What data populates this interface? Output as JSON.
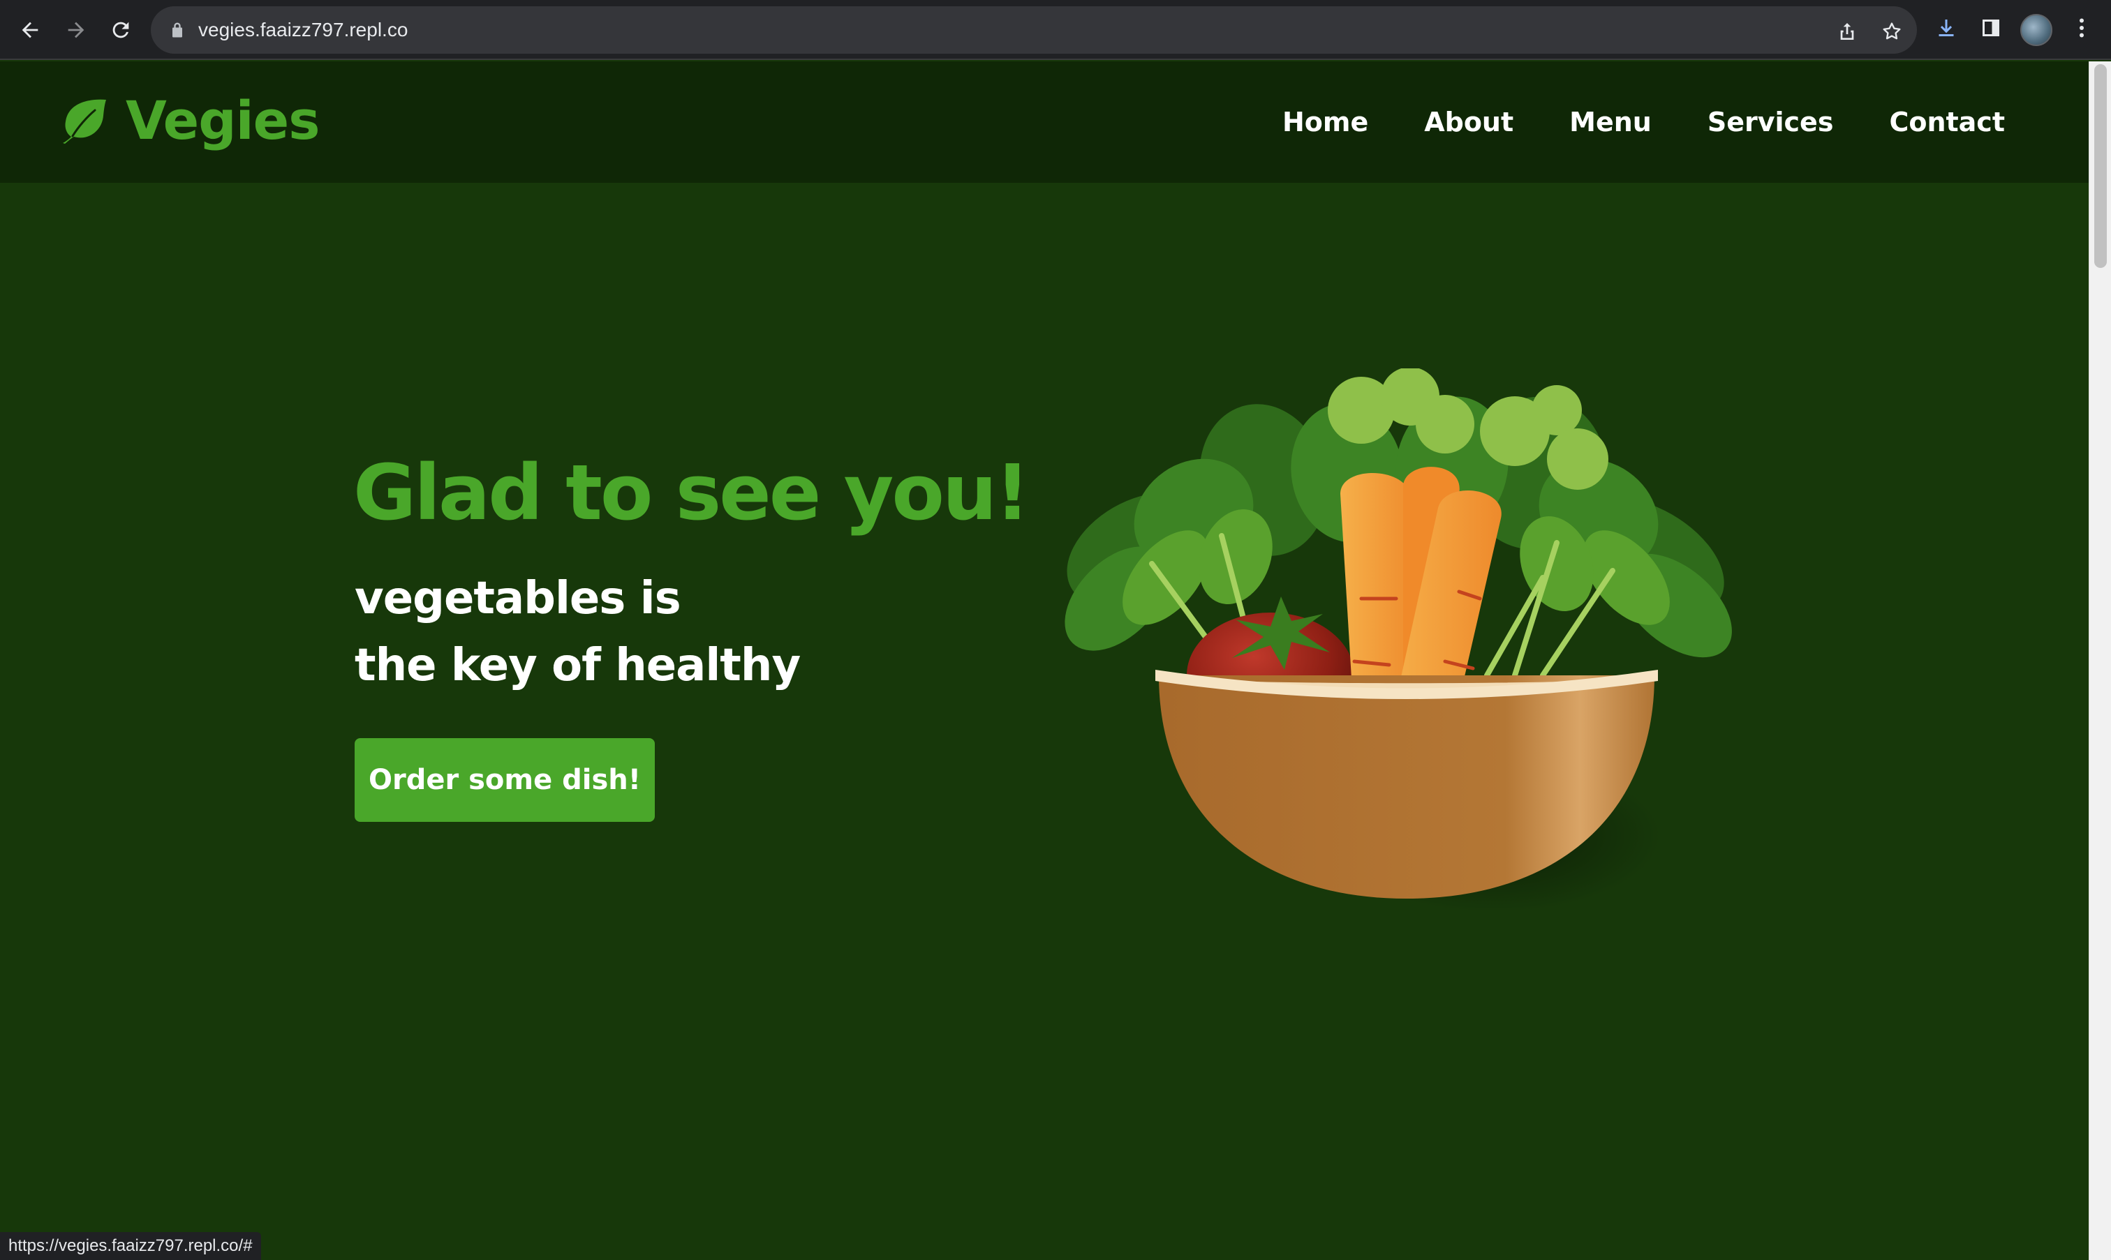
{
  "browser": {
    "url": "vegies.faaizz797.repl.co",
    "status_url": "https://vegies.faaizz797.repl.co/#"
  },
  "site": {
    "brand": "Vegies",
    "nav": [
      {
        "label": "Home"
      },
      {
        "label": "About"
      },
      {
        "label": "Menu"
      },
      {
        "label": "Services"
      },
      {
        "label": "Contact"
      }
    ]
  },
  "hero": {
    "title": "Glad to see you!",
    "subtitle_line1": "vegetables is",
    "subtitle_line2": "the key of healthy",
    "cta_label": "Order some dish!"
  },
  "colors": {
    "brand_green": "#4aa72a",
    "page_bg": "#17380a",
    "header_bg": "#0f2706"
  },
  "icons": {
    "logo": "leaf-icon",
    "hero_image": "salad-bowl-illustration"
  }
}
